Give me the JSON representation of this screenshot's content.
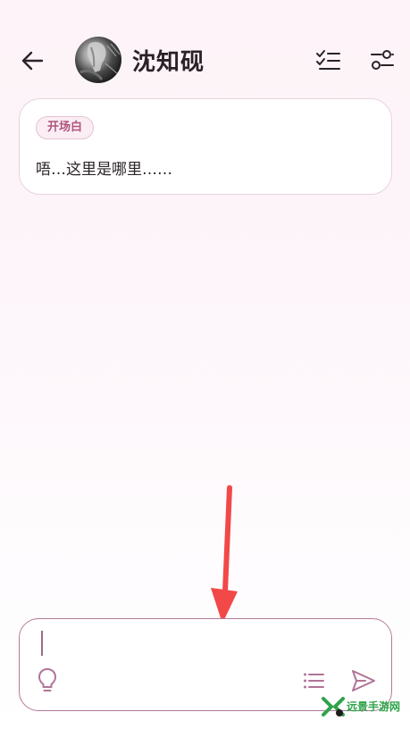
{
  "status_bar": {
    "time": "",
    "system": ""
  },
  "header": {
    "back_icon": "arrow-left-icon",
    "avatar_icon": "character-avatar",
    "name": "沈知砚",
    "checklist_icon": "checklist-icon",
    "settings_icon": "sliders-icon"
  },
  "opening": {
    "tag": "开场白",
    "text": "唔…这里是哪里……"
  },
  "composer": {
    "placeholder": "",
    "hint_icon": "lightbulb-icon",
    "list_icon": "list-icon",
    "send_icon": "send-icon"
  },
  "colors": {
    "accent": "#b0547d",
    "border": "#b57a9a",
    "arrow": "#f24848",
    "watermark": "#2fa34a"
  },
  "watermark": {
    "text": "远景手游网"
  }
}
